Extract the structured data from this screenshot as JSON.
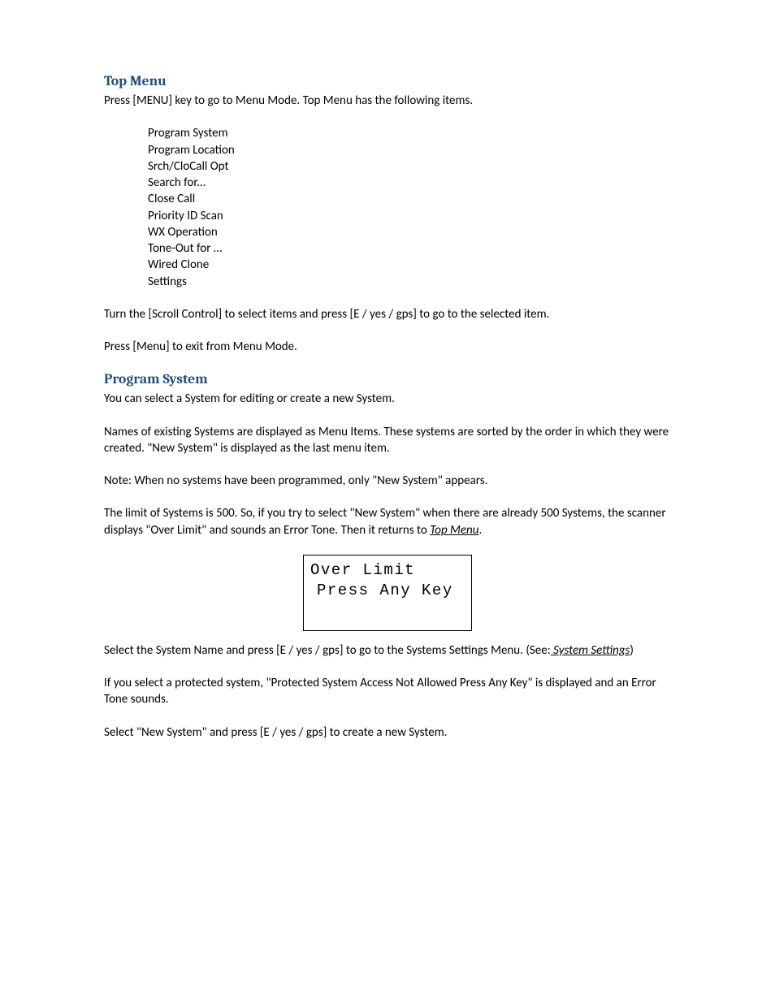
{
  "section1": {
    "heading": "Top Menu",
    "intro": "Press [MENU] key to go to Menu Mode. Top Menu has the following items.",
    "menu_items": [
      "Program System",
      "Program Location",
      "Srch/CloCall Opt",
      "Search for...",
      "Close Call",
      "Priority ID Scan",
      "WX Operation",
      "Tone-Out for …",
      "Wired Clone",
      "Settings"
    ],
    "para2": "Turn the [Scroll Control] to select items and press [E / yes / gps] to go to the selected item.",
    "para3": "Press [Menu] to exit from Menu Mode."
  },
  "section2": {
    "heading": "Program System",
    "para1": "You can select a System for editing or create a new System.",
    "para2": "Names of existing Systems are displayed as Menu Items. These systems are sorted by the order in which they were created. \"New System\" is displayed as the last menu item.",
    "para3": "Note: When no systems have been programmed, only \"New System\" appears.",
    "para4_pre": "The limit of Systems is 500. So, if you try to select \"New System\" when there are already 500 Systems, the scanner displays \"Over Limit\" and sounds an Error Tone. Then it returns to ",
    "para4_link": "Top Menu",
    "para4_post": ".",
    "display": {
      "line1": "Over Limit",
      "line2": "Press Any Key"
    },
    "para5_pre": "Select the System Name and press [E / yes / gps] to go to the Systems Settings Menu. (See:",
    "para5_link": " System Settings",
    "para5_post": ")",
    "para6": "If you select a protected system, \"Protected System    Access Not Allowed Press Any Key\" is displayed and an Error Tone sounds.",
    "para7": "Select \"New System\" and press [E / yes / gps] to create a new System."
  }
}
